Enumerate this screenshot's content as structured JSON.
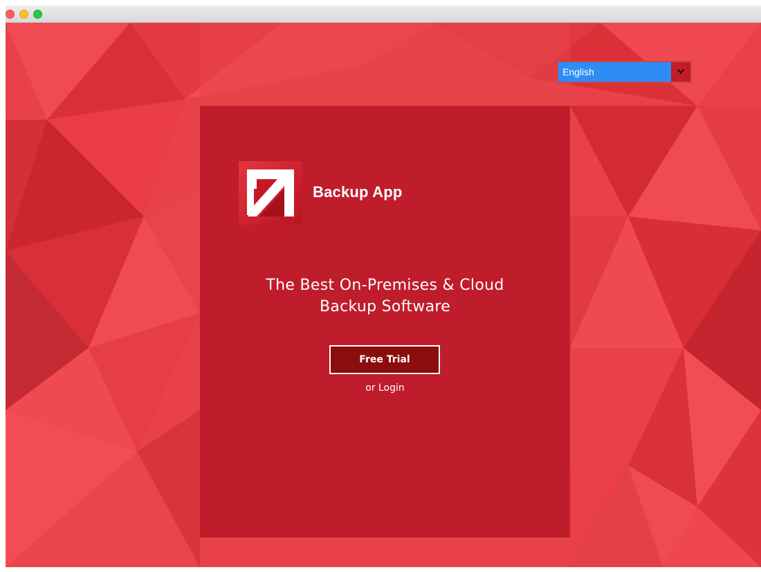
{
  "window": {
    "controls": [
      "close",
      "minimize",
      "zoom"
    ]
  },
  "language_selector": {
    "selected": "English",
    "icon": "chevron-down-icon"
  },
  "card": {
    "app_name": "Backup App",
    "logo_icon": "arrow-up-right-icon",
    "tagline_line1": "The Best On-Premises & Cloud",
    "tagline_line2": "Backup Software",
    "trial_label": "Free Trial",
    "login_label": "or Login"
  },
  "colors": {
    "background": "#e64047",
    "card": "#bf1c2c",
    "button": "#8c0d0d",
    "select_bg": "#2e8cf5",
    "select_arrow_bg": "#c41b28"
  }
}
